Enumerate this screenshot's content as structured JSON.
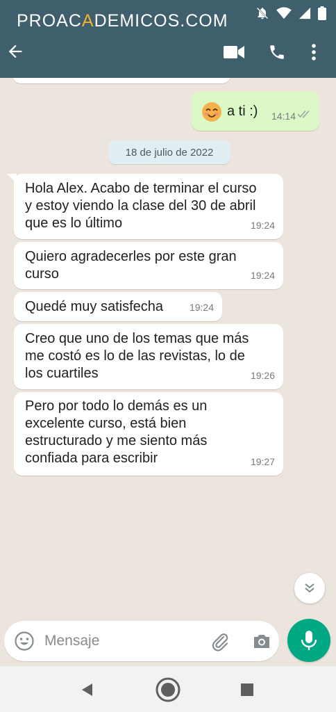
{
  "brand": {
    "before": "PROAC",
    "accent": "A",
    "after": "DEMICOS.COM"
  },
  "status_icons": [
    "bell-off-icon",
    "wifi-icon",
    "signal-icon",
    "battery-icon"
  ],
  "appbar": {
    "back_icon": "arrow-left-icon",
    "actions": [
      "video-call-icon",
      "voice-call-icon",
      "more-vert-icon"
    ]
  },
  "colors": {
    "header": "#3e5f6b",
    "brand_accent": "#f2b134",
    "chat_background": "#ece5dd",
    "outgoing_bubble": "#dcf8c6",
    "incoming_bubble": "#ffffff",
    "mic_button": "#00a884",
    "read_ticks": "#9aa5a9"
  },
  "chat": {
    "outgoing": {
      "emoji": "smiling-face-icon",
      "text": "a ti :)",
      "time": "14:14",
      "status_icon": "double-check-icon"
    },
    "date_separator": "18 de julio de 2022",
    "messages": [
      {
        "lines": [
          "Hola Alex. Acabo de terminar el curso",
          "y estoy viendo la clase del 30 de abril",
          "que es lo último"
        ],
        "time": "19:24"
      },
      {
        "lines": [
          "Quiero agradecerles por este gran",
          "curso"
        ],
        "time": "19:24"
      },
      {
        "lines": [
          "Quedé muy satisfecha"
        ],
        "time": "19:24"
      },
      {
        "lines": [
          "Creo que uno de los temas que más",
          "me costó es lo de las revistas, lo de",
          "los cuartiles"
        ],
        "time": "19:26"
      },
      {
        "lines": [
          "Pero por todo lo demás es un",
          "excelente curso, está bien",
          "estructurado y me siento más",
          "confiada para escribir"
        ],
        "time": "19:27"
      }
    ],
    "scroll_down_icon": "double-chevron-down-icon"
  },
  "composer": {
    "placeholder": "Mensaje",
    "emoji_icon": "emoji-icon",
    "attach_icon": "paperclip-icon",
    "camera_icon": "camera-icon",
    "mic_icon": "microphone-icon"
  },
  "navbar": [
    "back-triangle-icon",
    "home-circle-icon",
    "recents-square-icon"
  ]
}
